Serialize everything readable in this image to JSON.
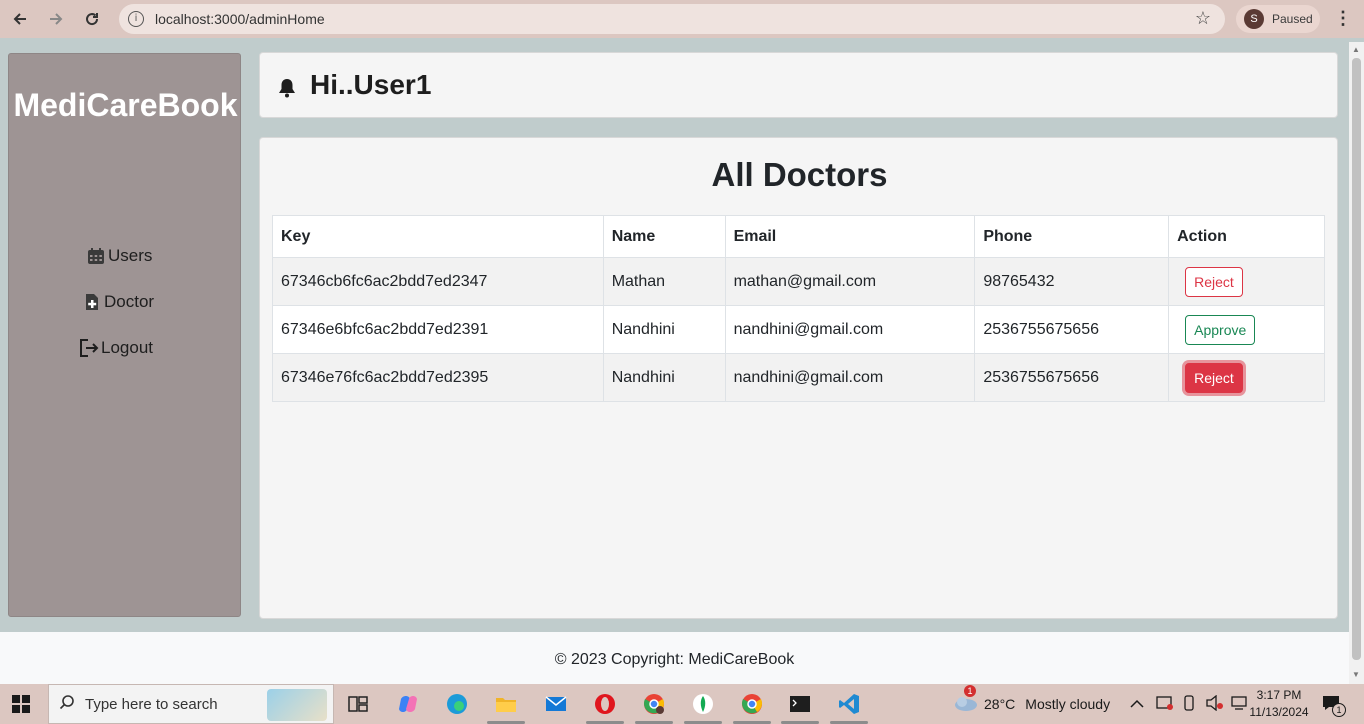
{
  "browser": {
    "url": "localhost:3000/adminHome",
    "profile_initial": "S",
    "profile_status": "Paused"
  },
  "sidebar": {
    "brand": "MediCareBook",
    "items": [
      {
        "label": "Users",
        "icon": "calendar-icon"
      },
      {
        "label": "Doctor",
        "icon": "doctor-file-icon"
      },
      {
        "label": "Logout",
        "icon": "logout-icon"
      }
    ]
  },
  "header": {
    "greeting": "Hi..User1",
    "icon": "bell-icon"
  },
  "main": {
    "title": "All Doctors",
    "table": {
      "columns": [
        "Key",
        "Name",
        "Email",
        "Phone",
        "Action"
      ],
      "rows": [
        {
          "key": "67346cb6fc6ac2bdd7ed2347",
          "name": "Mathan",
          "email": "mathan@gmail.com",
          "phone": "98765432",
          "action": "Reject"
        },
        {
          "key": "67346e6bfc6ac2bdd7ed2391",
          "name": "Nandhini",
          "email": "nandhini@gmail.com",
          "phone": "2536755675656",
          "action": "Approve"
        },
        {
          "key": "67346e76fc6ac2bdd7ed2395",
          "name": "Nandhini",
          "email": "nandhini@gmail.com",
          "phone": "2536755675656",
          "action": "Reject"
        }
      ]
    }
  },
  "footer": {
    "text": "© 2023 Copyright: MediCareBook"
  },
  "taskbar": {
    "search_placeholder": "Type here to search",
    "weather_badge": "1",
    "weather_temp": "28°C",
    "weather_text": "Mostly cloudy",
    "time": "3:17 PM",
    "date": "11/13/2024",
    "notification_count": "1"
  },
  "colors": {
    "page_bg": "#c0cccc",
    "sidebar_bg": "#9e9494",
    "danger": "#dc3545",
    "success": "#198754",
    "chrome_bg": "#dcc7c1"
  }
}
